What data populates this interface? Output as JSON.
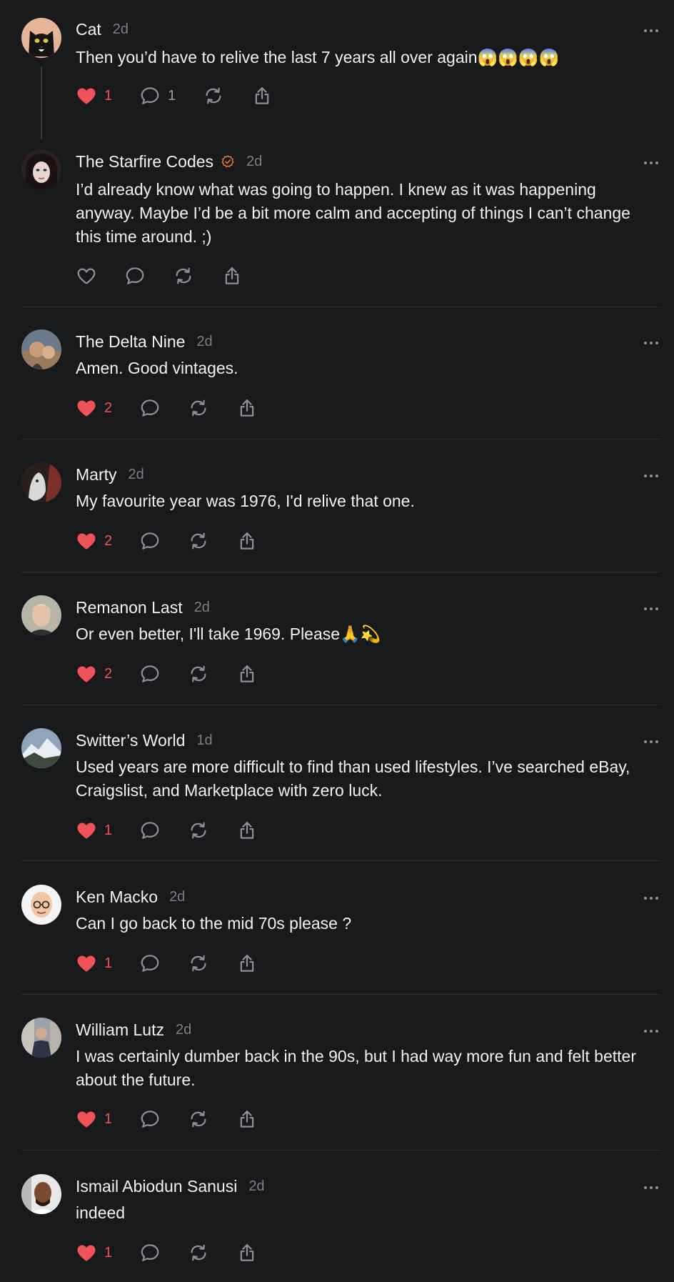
{
  "icons": {
    "like_filled": "heart-filled-icon",
    "like_outline": "heart-outline-icon",
    "reply": "chat-bubble-icon",
    "repost": "repost-icon",
    "share": "share-icon",
    "more": "more-horizontal-icon",
    "verified": "verified-badge-icon"
  },
  "colors": {
    "background": "#18191b",
    "like": "#f0525a",
    "icon": "#8e8f94",
    "verified": "#f07a2e"
  },
  "posts": [
    {
      "name": "Cat",
      "time": "2d",
      "text": "Then you’d have to relive the last 7 years all over again😱😱😱😱",
      "likes": "1",
      "liked": true,
      "replies": "1",
      "verified": false
    },
    {
      "name": "The Starfire Codes",
      "time": "2d",
      "text": "I’d already know what was going to happen. I knew as it was happening anyway. Maybe I’d be a bit more calm and accepting of things I can’t change this time around. ;)",
      "likes": "",
      "liked": false,
      "replies": "",
      "verified": true
    },
    {
      "name": "The Delta Nine",
      "time": "2d",
      "text": "Amen. Good vintages.",
      "likes": "2",
      "liked": true,
      "replies": "",
      "verified": false
    },
    {
      "name": "Marty",
      "time": "2d",
      "text": "My favourite year was 1976, I'd relive that one.",
      "likes": "2",
      "liked": true,
      "replies": "",
      "verified": false
    },
    {
      "name": "Remanon Last",
      "time": "2d",
      "text": "Or even better, I'll take 1969. Please🙏💫",
      "likes": "2",
      "liked": true,
      "replies": "",
      "verified": false
    },
    {
      "name": "Switter’s World",
      "time": "1d",
      "text": "Used years are more difficult to find than used lifestyles. I’ve searched eBay, Craigslist, and Marketplace with zero luck.",
      "likes": "1",
      "liked": true,
      "replies": "",
      "verified": false
    },
    {
      "name": "Ken Macko",
      "time": "2d",
      "text": "Can I go back to the mid 70s please ?",
      "likes": "1",
      "liked": true,
      "replies": "",
      "verified": false
    },
    {
      "name": "William Lutz",
      "time": "2d",
      "text": "I was certainly dumber back in the 90s, but I had way more fun and felt better about the future.",
      "likes": "1",
      "liked": true,
      "replies": "",
      "verified": false
    },
    {
      "name": "Ismail Abiodun Sanusi",
      "time": "2d",
      "text": "indeed",
      "likes": "1",
      "liked": true,
      "replies": "",
      "verified": false
    }
  ]
}
